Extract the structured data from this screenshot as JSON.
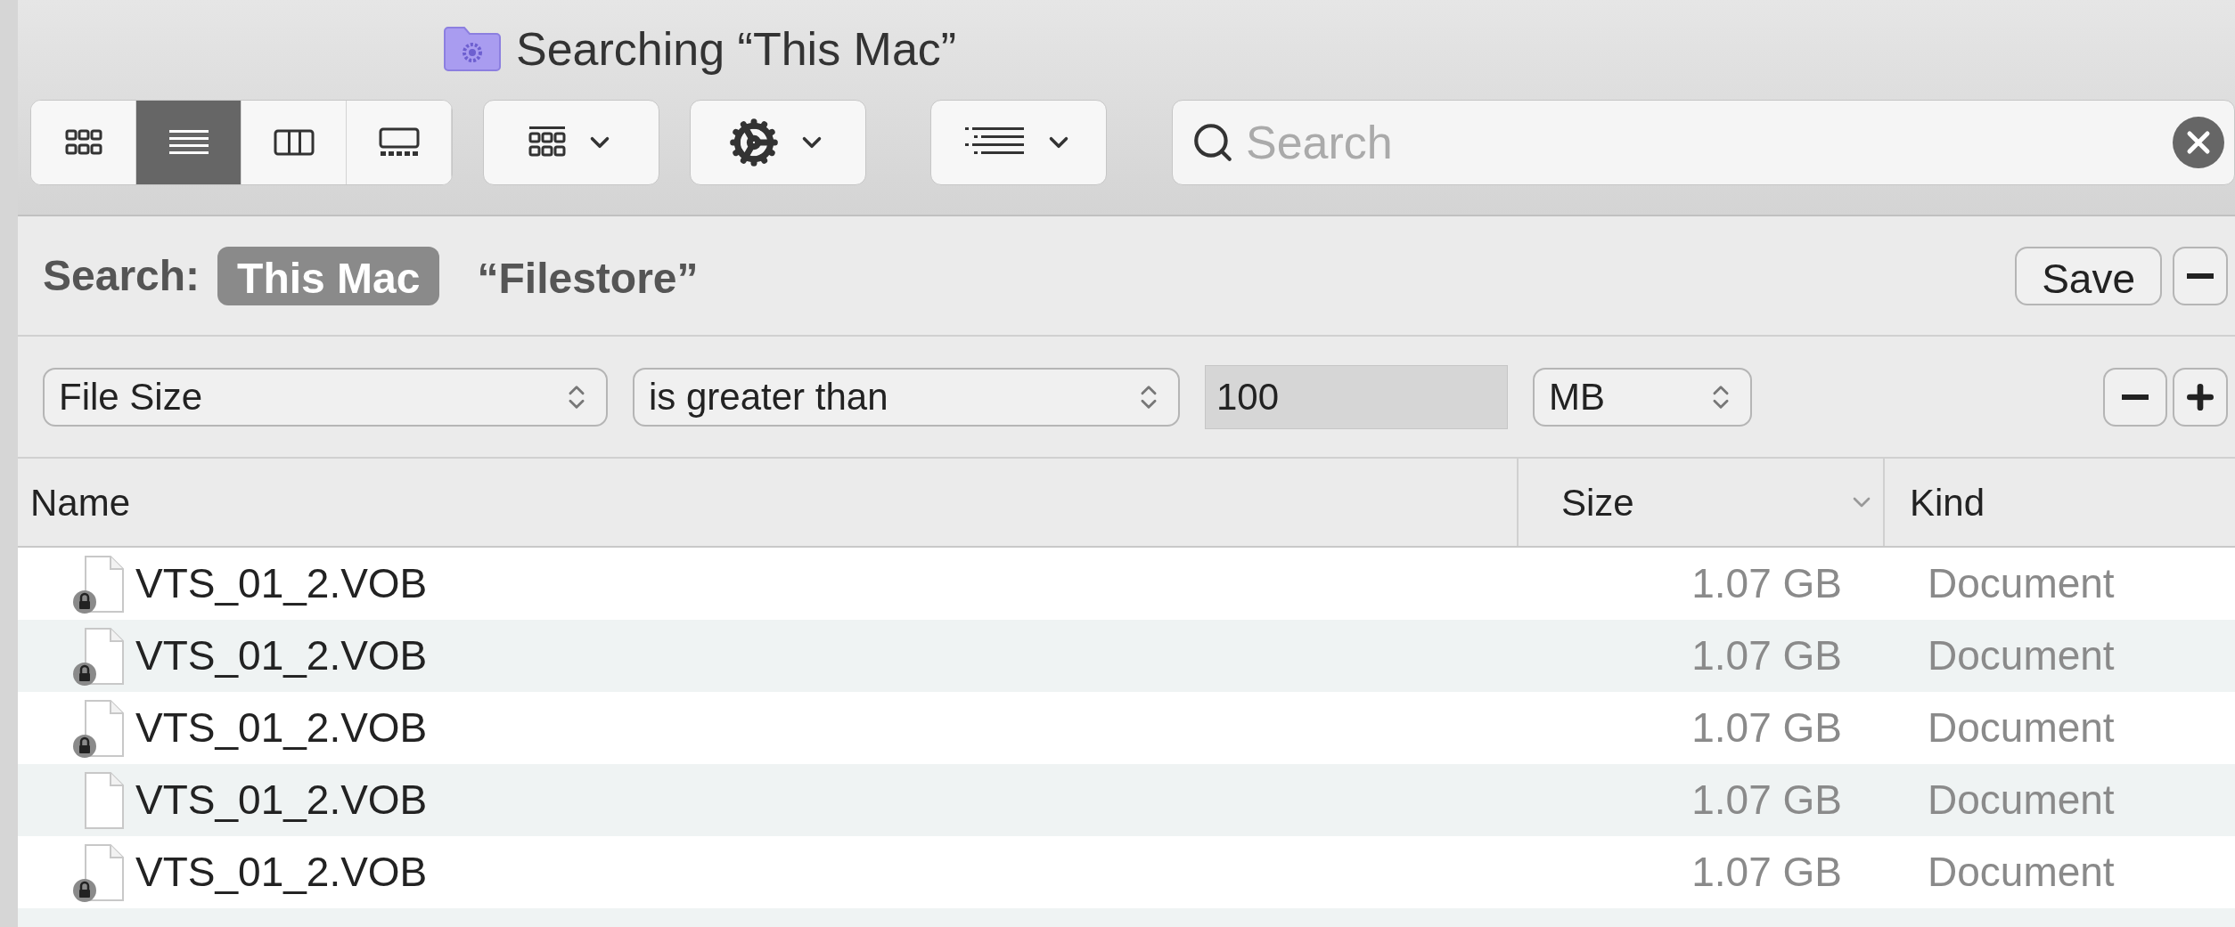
{
  "window": {
    "title": "Searching “This Mac”"
  },
  "toolbar": {
    "view_modes": [
      {
        "kind": "icons",
        "selected": false
      },
      {
        "kind": "list",
        "selected": true
      },
      {
        "kind": "columns",
        "selected": false
      },
      {
        "kind": "gallery",
        "selected": false
      }
    ]
  },
  "search": {
    "placeholder": "Search"
  },
  "scope_bar": {
    "label": "Search:",
    "scopes": [
      {
        "label": "This Mac",
        "selected": true
      },
      {
        "label": "“Filestore”",
        "selected": false
      }
    ],
    "save": "Save"
  },
  "criteria": {
    "attribute": "File Size",
    "operator": "is greater than",
    "value": "100",
    "unit": "MB"
  },
  "table": {
    "columns": [
      {
        "label": "Name",
        "sorted": false
      },
      {
        "label": "Size",
        "sorted": true
      },
      {
        "label": "Kind",
        "sorted": false
      }
    ],
    "rows": [
      {
        "name": "VTS_01_2.VOB",
        "size": "1.07 GB",
        "file_kind": "Document",
        "locked": true
      },
      {
        "name": "VTS_01_2.VOB",
        "size": "1.07 GB",
        "file_kind": "Document",
        "locked": true
      },
      {
        "name": "VTS_01_2.VOB",
        "size": "1.07 GB",
        "file_kind": "Document",
        "locked": true
      },
      {
        "name": "VTS_01_2.VOB",
        "size": "1.07 GB",
        "file_kind": "Document",
        "locked": false
      },
      {
        "name": "VTS_01_2.VOB",
        "size": "1.07 GB",
        "file_kind": "Document",
        "locked": true
      }
    ]
  }
}
